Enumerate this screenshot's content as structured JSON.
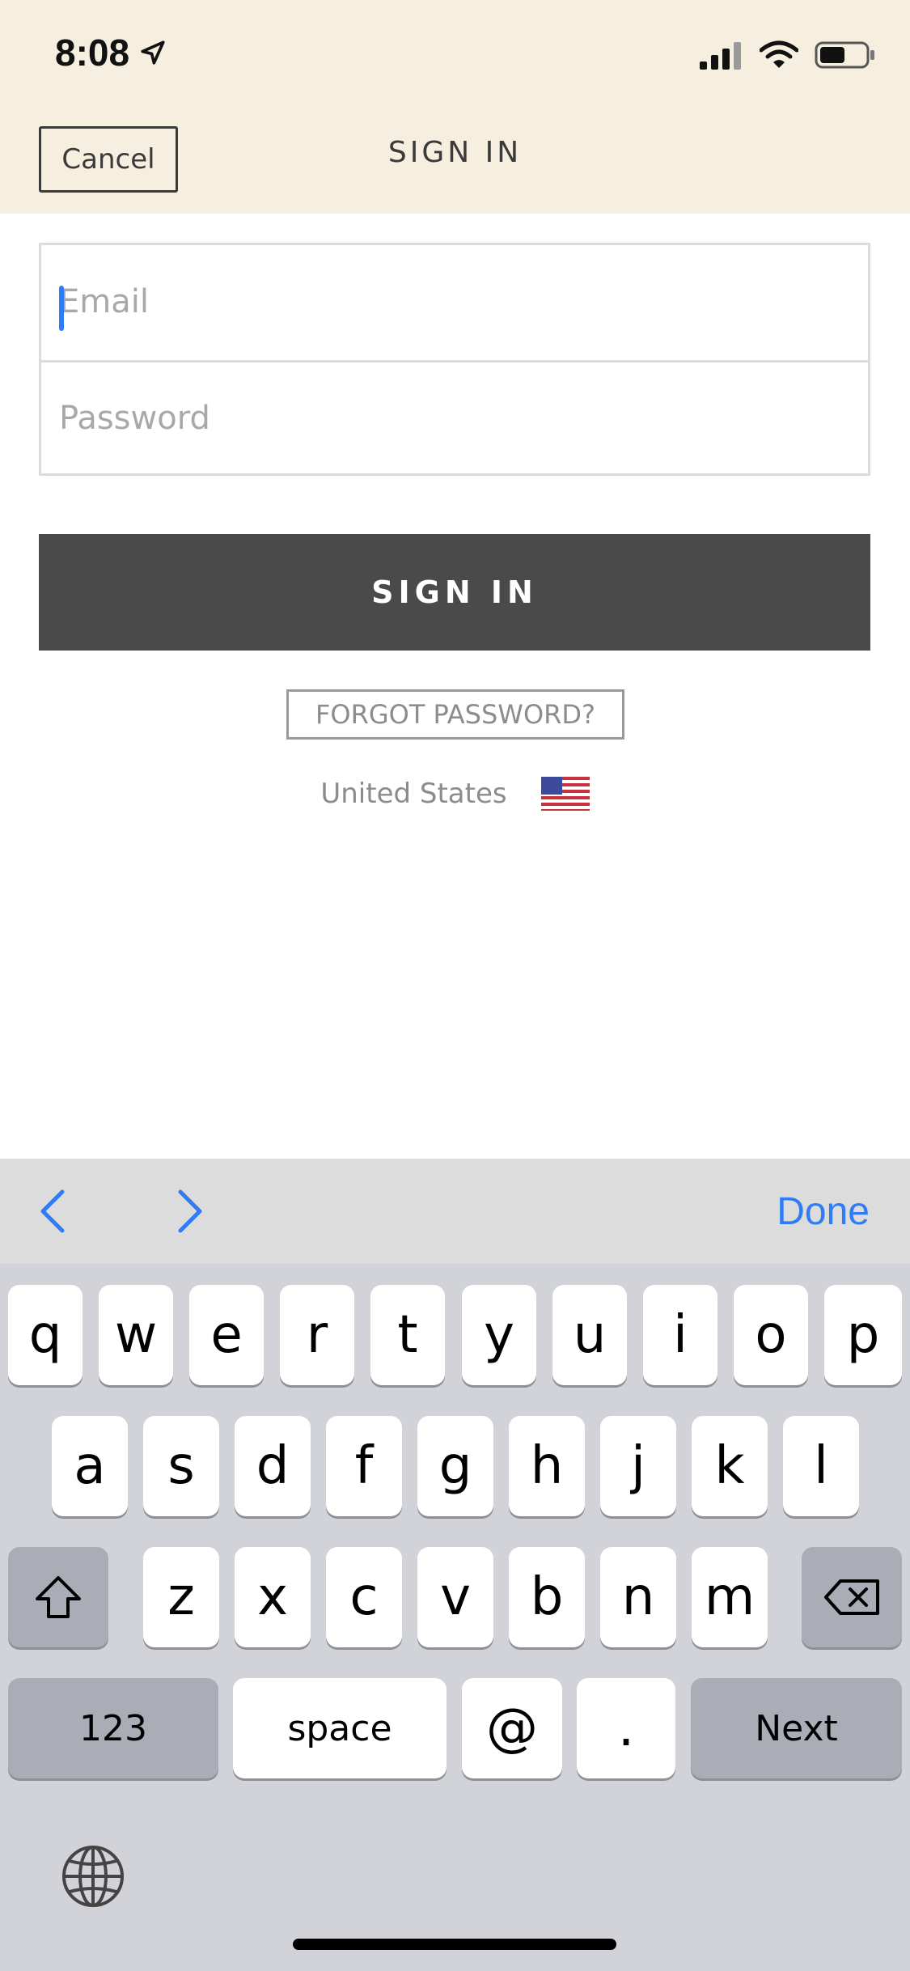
{
  "status_bar": {
    "time": "8:08"
  },
  "header": {
    "cancel_label": "Cancel",
    "title": "SIGN IN"
  },
  "form": {
    "email_placeholder": "Email",
    "password_placeholder": "Password",
    "signin_label": "SIGN IN",
    "forgot_label": "FORGOT PASSWORD?",
    "country": "United States"
  },
  "keyboard": {
    "done_label": "Done",
    "row1": [
      "q",
      "w",
      "e",
      "r",
      "t",
      "y",
      "u",
      "i",
      "o",
      "p"
    ],
    "row2": [
      "a",
      "s",
      "d",
      "f",
      "g",
      "h",
      "j",
      "k",
      "l"
    ],
    "row3": [
      "z",
      "x",
      "c",
      "v",
      "b",
      "n",
      "m"
    ],
    "numbers_label": "123",
    "space_label": "space",
    "at_label": "@",
    "dot_label": ".",
    "next_label": "Next"
  },
  "colors": {
    "header_bg": "#f6efdf",
    "primary_button": "#4a4a4a",
    "accent_blue": "#2f7cf6",
    "keyboard_bg": "#d1d3d9"
  }
}
